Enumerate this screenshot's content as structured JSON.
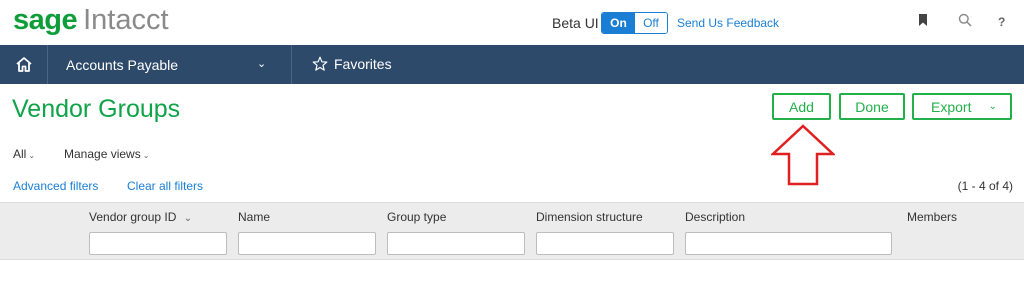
{
  "header": {
    "logo_primary": "sage",
    "logo_secondary": "Intacct",
    "beta_label": "Beta UI",
    "toggle_on": "On",
    "toggle_off": "Off",
    "feedback_link": "Send Us Feedback",
    "help_label": "?"
  },
  "nav": {
    "module": "Accounts Payable",
    "favorites": "Favorites"
  },
  "page": {
    "title": "Vendor Groups",
    "buttons": {
      "add": "Add",
      "done": "Done",
      "export": "Export"
    }
  },
  "filters": {
    "view": "All",
    "manage_views": "Manage views",
    "advanced": "Advanced filters",
    "clear": "Clear all filters",
    "record_count": "(1 - 4 of 4)"
  },
  "grid": {
    "columns": [
      {
        "label": "Vendor group ID",
        "sortable": true
      },
      {
        "label": "Name"
      },
      {
        "label": "Group type"
      },
      {
        "label": "Dimension structure"
      },
      {
        "label": "Description"
      },
      {
        "label": "Members"
      }
    ]
  },
  "colors": {
    "brand_green": "#10a34a",
    "nav_bg": "#2d4a6b",
    "link_blue": "#1a7fd4",
    "annotation_red": "#e02020"
  }
}
